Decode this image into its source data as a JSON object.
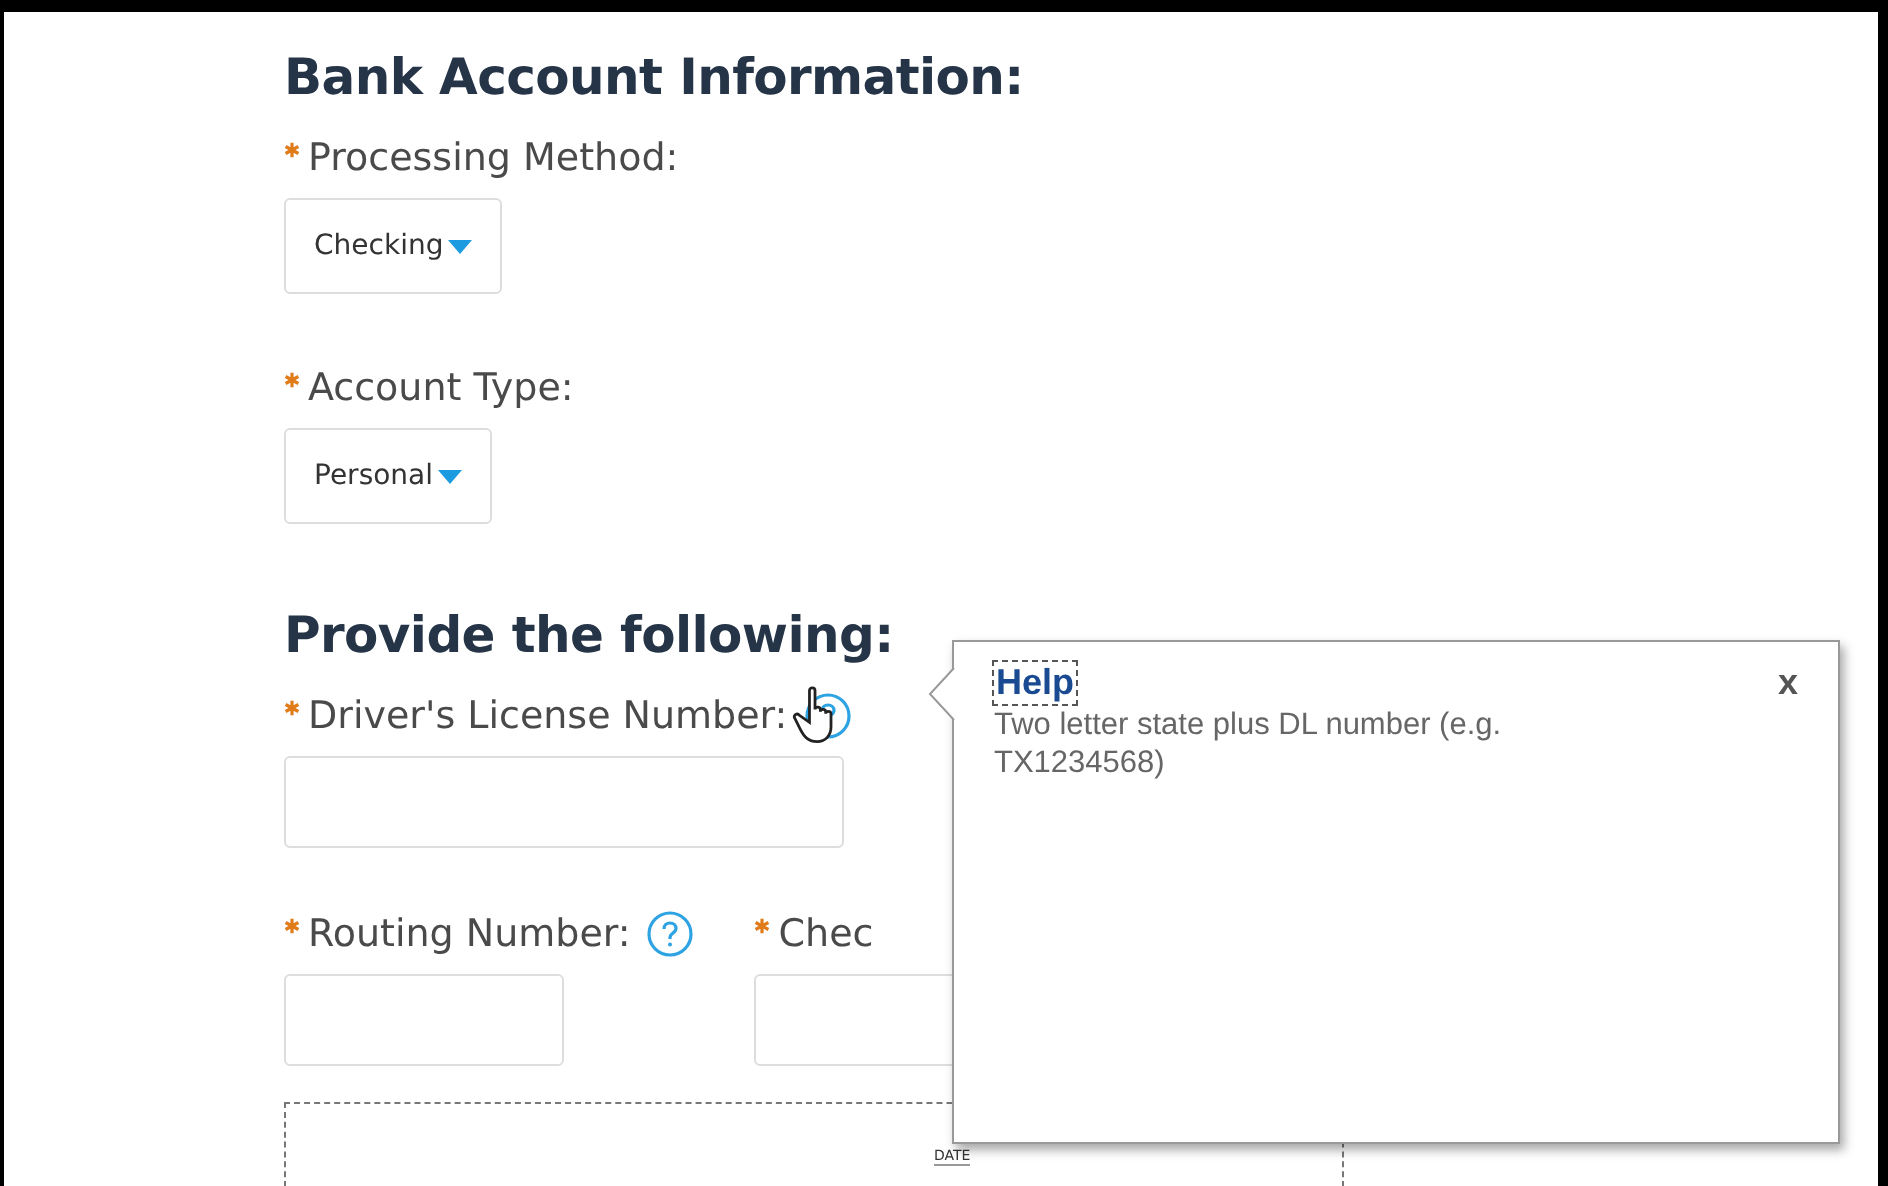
{
  "sections": [
    {
      "heading": "Bank Account Information:",
      "fields": [
        {
          "kind": "select",
          "label": "Processing Method:",
          "required": true,
          "value": "Checking"
        },
        {
          "kind": "select",
          "label": "Account Type:",
          "required": true,
          "value": "Personal"
        }
      ]
    },
    {
      "heading": "Provide the following:",
      "fields": [
        {
          "kind": "text",
          "label": "Driver's License Number:",
          "required": true,
          "help": true
        }
      ]
    }
  ],
  "row_fields": [
    {
      "label": "Routing Number:",
      "required": true,
      "help": true
    },
    {
      "label": "Chec",
      "required": true,
      "help": false
    }
  ],
  "check_image": {
    "date_label": "DATE"
  },
  "help_popup": {
    "title": "Help",
    "text": "Two letter state plus DL number (e.g. TX1234568)",
    "close": "x"
  }
}
